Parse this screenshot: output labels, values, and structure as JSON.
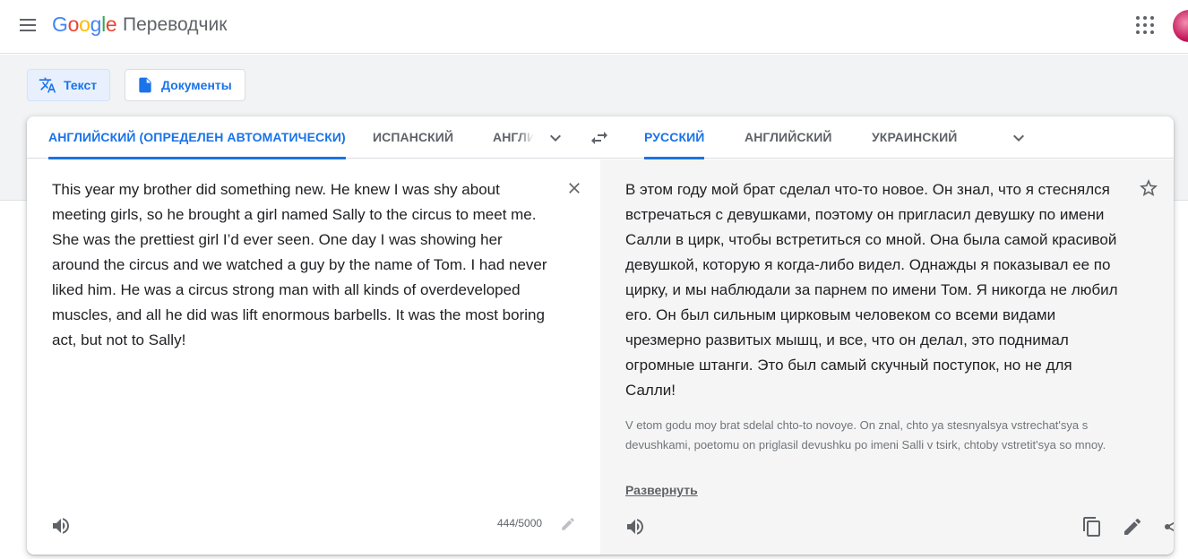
{
  "header": {
    "logo": [
      "G",
      "o",
      "o",
      "g",
      "l",
      "e"
    ],
    "product": "Переводчик"
  },
  "modes": {
    "text": "Текст",
    "documents": "Документы"
  },
  "source_langs": {
    "detected": "АНГЛИЙСКИЙ (ОПРЕДЕЛЕН АВТОМАТИЧЕСКИ)",
    "lang2": "ИСПАНСКИЙ",
    "lang3": "АНГЛИЙСКИЙ"
  },
  "target_langs": {
    "lang1": "РУССКИЙ",
    "lang2": "АНГЛИЙСКИЙ",
    "lang3": "УКРАИНСКИЙ"
  },
  "source": {
    "text": "This year my brother did something new. He knew I was shy about meeting girls, so he brought a girl named Sally to the circus to meet me.\nShe was the prettiest girl I’d ever seen. One day I was showing her around the circus and we watched a guy by the name of Tom. I had never liked him. He was a circus strong man with all kinds of overdeveloped muscles, and all he did was lift enormous barbells. It was the most boring act, but not to Sally!",
    "counter": "444/5000"
  },
  "target": {
    "text": "В этом году мой брат сделал что-то новое. Он знал, что я стеснялся встречаться с девушками, поэтому он пригласил девушку по имени Салли в цирк, чтобы встретиться со мной. Она была самой красивой девушкой, которую я когда-либо видел. Однажды я показывал ее по цирку, и мы наблюдали за парнем по имени Том. Я никогда не любил его. Он был сильным цирковым человеком со всеми видами чрезмерно развитых мышц, и все, что он делал, это поднимал огромные штанги. Это был самый скучный поступок, но не для Салли!",
    "transliteration": "V etom godu moy brat sdelal chto-to novoye. On znal, chto ya stesnyalsya vstrechat'sya s devushkami, poetomu on priglasil devushku po imeni Salli v tsirk, chtoby vstretit'sya so mnoy.",
    "expand_label": "Развернуть"
  },
  "colors": {
    "accent": "#1a73e8",
    "target_bg": "#f5f5f5"
  }
}
